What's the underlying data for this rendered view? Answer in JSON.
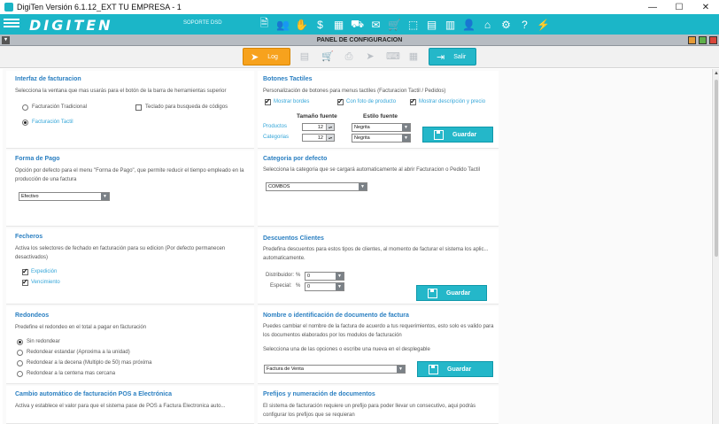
{
  "window": {
    "title": "DigiTen Versión 6.1.12_EXT TU EMPRESA - 1",
    "minimize": "—",
    "maximize": "☐",
    "close": "✕"
  },
  "toolbar": {
    "logo": "DIGITEN",
    "soporte": "SOPORTE DSD",
    "icons": [
      "invoice-icon",
      "users-icon",
      "handshake-icon",
      "money-icon",
      "inventory-icon",
      "truck-icon",
      "purchase-icon",
      "cart-icon",
      "boxes-icon",
      "document-icon",
      "chart-icon",
      "employee-icon",
      "bank-icon",
      "gear-icon",
      "help-icon",
      "plug-icon"
    ]
  },
  "panel": {
    "title": "PANEL DE CONFIGURACION",
    "log_label": "Log",
    "exit_label": "Salir"
  },
  "sections": {
    "interfaz": {
      "title": "Interfaz de facturacion",
      "desc": "Selecciona la ventana que mas usarás para el botón de la barra de herramientas superior",
      "opt1": "Facturación Tradicional",
      "opt2": "Facturación Tactil",
      "keyboard": "Teclado para busqueda de códigos",
      "selected": "Facturación Tactil"
    },
    "botones": {
      "title": "Botones Tactiles",
      "desc": "Personalización de botones para  menus tactiles (Facturacion Tactil / Pedidos)",
      "chk1": "Mostrar bordes",
      "chk2": "Con foto de producto",
      "chk3": "Mostrar descripción y precio",
      "col_size": "Tamaño fuente",
      "col_style": "Estilo fuente",
      "row1_label": "Productos",
      "row1_size": "12",
      "row1_style": "Negrita",
      "row2_label": "Categorias",
      "row2_size": "12",
      "row2_style": "Negrita",
      "save": "Guardar"
    },
    "pago": {
      "title": "Forma de Pago",
      "desc": "Opción por defecto para el menu \"Forma de Pago\", que permite reducir el tiempo  empleado en la producción de una factura",
      "value": "Efectivo"
    },
    "categoria": {
      "title": "Categoria por defecto",
      "desc": "Selecciona la categoria que se cargará automaticamente al abrir Facturacion o Pedido Tactil",
      "value": "COMBOS"
    },
    "fecheros": {
      "title": "Fecheros",
      "desc": "Activa los selectores de fechado en facturación para su edicion (Por defecto permanecen desactivados)",
      "chk1": "Expedición",
      "chk2": "Vencimiento"
    },
    "descuentos": {
      "title": "Descuentos Clientes",
      "desc": "Predefina descuentos para estos tipos de clientes, al momento de facturar el sistema los aplic... automaticamente.",
      "dist_label": "Distribuidor:",
      "esp_label": "Especial:",
      "percent": "%",
      "dist_value": "0",
      "esp_value": "0",
      "save": "Guardar"
    },
    "redondeos": {
      "title": "Redondeos",
      "desc": "Predefine el redondeo en el total a pagar en fàcturación",
      "opt1": "Sin redondear",
      "opt2": "Redondear estandar (Aproxima a la unidad)",
      "opt3": "Redondear a la decena (Multiplo de 50) mas próxima",
      "opt4": "Redondear a la centena mas cercana",
      "selected": "Sin redondear"
    },
    "nombre_doc": {
      "title": "Nombre o identificación de documento de factura",
      "desc": "Puedes cambiar el nombre de la factura de acuerdo a tus requerimientos, esto solo es valido para los documentos elaborados por los modulos de facturación",
      "hint": "Selecciona una de las opciones o escribe una nueva en el desplegable",
      "value": "Factura de Venta",
      "save": "Guardar"
    },
    "pos": {
      "title": "Cambio automático de facturación POS a Electrónica",
      "desc": "Activa y establece el valor para que el sistema  pase de POS a Factura Electronica auto..."
    },
    "prefijos": {
      "title": "Prefijos y numeración de documentos",
      "desc": "El sistema de facturación requiere un prefijo para poder llevar un consecutivo, aqui podrás configurar los prefijos que se requieran"
    }
  }
}
